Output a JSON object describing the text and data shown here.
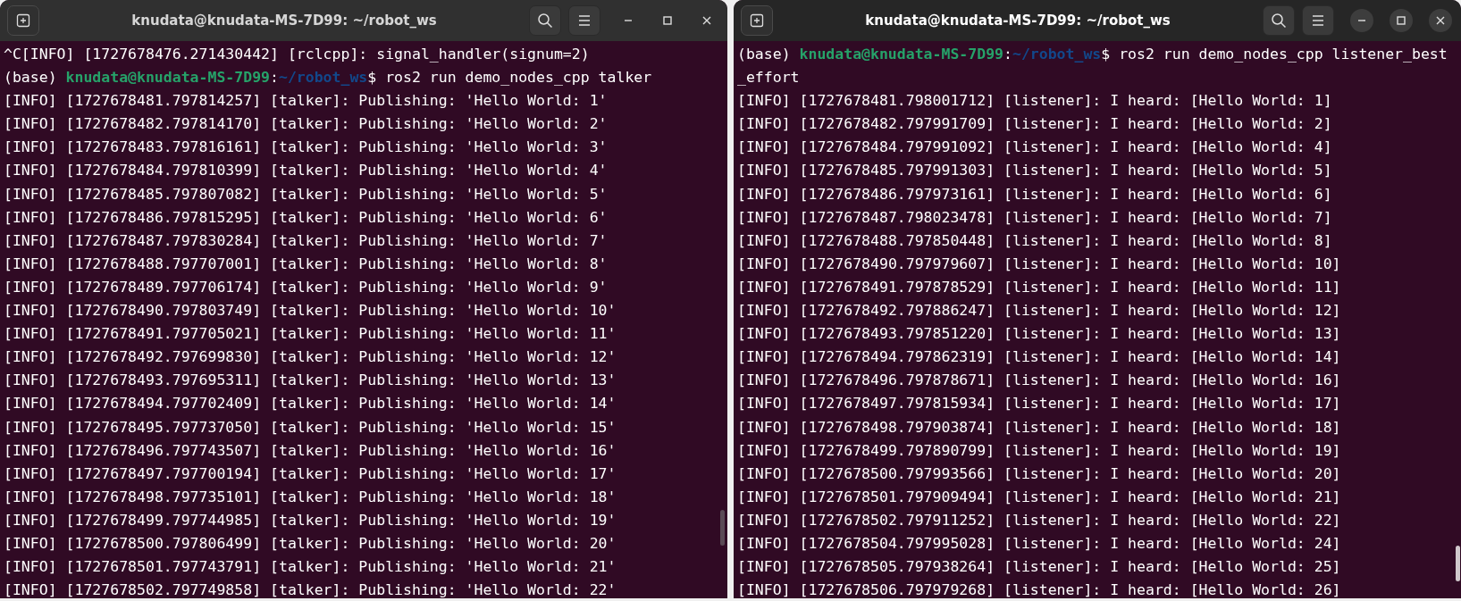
{
  "windows": [
    {
      "title": "knudata@knudata-MS-7D99: ~/robot_ws",
      "focused": false,
      "lines": [
        {
          "kind": "text",
          "text": "^C[INFO] [1727678476.271430442] [rclcpp]: signal_handler(signum=2)"
        },
        {
          "kind": "prompt",
          "env": "(base)",
          "user": "knudata@knudata-MS-7D99",
          "sep": ":",
          "path": "~/robot_ws",
          "command": "$ ros2 run demo_nodes_cpp talker"
        },
        {
          "kind": "text",
          "text": "[INFO] [1727678481.797814257] [talker]: Publishing: 'Hello World: 1'"
        },
        {
          "kind": "text",
          "text": "[INFO] [1727678482.797814170] [talker]: Publishing: 'Hello World: 2'"
        },
        {
          "kind": "text",
          "text": "[INFO] [1727678483.797816161] [talker]: Publishing: 'Hello World: 3'"
        },
        {
          "kind": "text",
          "text": "[INFO] [1727678484.797810399] [talker]: Publishing: 'Hello World: 4'"
        },
        {
          "kind": "text",
          "text": "[INFO] [1727678485.797807082] [talker]: Publishing: 'Hello World: 5'"
        },
        {
          "kind": "text",
          "text": "[INFO] [1727678486.797815295] [talker]: Publishing: 'Hello World: 6'"
        },
        {
          "kind": "text",
          "text": "[INFO] [1727678487.797830284] [talker]: Publishing: 'Hello World: 7'"
        },
        {
          "kind": "text",
          "text": "[INFO] [1727678488.797707001] [talker]: Publishing: 'Hello World: 8'"
        },
        {
          "kind": "text",
          "text": "[INFO] [1727678489.797706174] [talker]: Publishing: 'Hello World: 9'"
        },
        {
          "kind": "text",
          "text": "[INFO] [1727678490.797803749] [talker]: Publishing: 'Hello World: 10'"
        },
        {
          "kind": "text",
          "text": "[INFO] [1727678491.797705021] [talker]: Publishing: 'Hello World: 11'"
        },
        {
          "kind": "text",
          "text": "[INFO] [1727678492.797699830] [talker]: Publishing: 'Hello World: 12'"
        },
        {
          "kind": "text",
          "text": "[INFO] [1727678493.797695311] [talker]: Publishing: 'Hello World: 13'"
        },
        {
          "kind": "text",
          "text": "[INFO] [1727678494.797702409] [talker]: Publishing: 'Hello World: 14'"
        },
        {
          "kind": "text",
          "text": "[INFO] [1727678495.797737050] [talker]: Publishing: 'Hello World: 15'"
        },
        {
          "kind": "text",
          "text": "[INFO] [1727678496.797743507] [talker]: Publishing: 'Hello World: 16'"
        },
        {
          "kind": "text",
          "text": "[INFO] [1727678497.797700194] [talker]: Publishing: 'Hello World: 17'"
        },
        {
          "kind": "text",
          "text": "[INFO] [1727678498.797735101] [talker]: Publishing: 'Hello World: 18'"
        },
        {
          "kind": "text",
          "text": "[INFO] [1727678499.797744985] [talker]: Publishing: 'Hello World: 19'"
        },
        {
          "kind": "text",
          "text": "[INFO] [1727678500.797806499] [talker]: Publishing: 'Hello World: 20'"
        },
        {
          "kind": "text",
          "text": "[INFO] [1727678501.797743791] [talker]: Publishing: 'Hello World: 21'"
        },
        {
          "kind": "text",
          "text": "[INFO] [1727678502.797749858] [talker]: Publishing: 'Hello World: 22'"
        }
      ]
    },
    {
      "title": "knudata@knudata-MS-7D99: ~/robot_ws",
      "focused": true,
      "lines": [
        {
          "kind": "prompt",
          "env": "(base)",
          "user": "knudata@knudata-MS-7D99",
          "sep": ":",
          "path": "~/robot_ws",
          "command": "$ ros2 run demo_nodes_cpp listener_best"
        },
        {
          "kind": "text",
          "text": "_effort"
        },
        {
          "kind": "text",
          "text": "[INFO] [1727678481.798001712] [listener]: I heard: [Hello World: 1]"
        },
        {
          "kind": "text",
          "text": "[INFO] [1727678482.797991709] [listener]: I heard: [Hello World: 2]"
        },
        {
          "kind": "text",
          "text": "[INFO] [1727678484.797991092] [listener]: I heard: [Hello World: 4]"
        },
        {
          "kind": "text",
          "text": "[INFO] [1727678485.797991303] [listener]: I heard: [Hello World: 5]"
        },
        {
          "kind": "text",
          "text": "[INFO] [1727678486.797973161] [listener]: I heard: [Hello World: 6]"
        },
        {
          "kind": "text",
          "text": "[INFO] [1727678487.798023478] [listener]: I heard: [Hello World: 7]"
        },
        {
          "kind": "text",
          "text": "[INFO] [1727678488.797850448] [listener]: I heard: [Hello World: 8]"
        },
        {
          "kind": "text",
          "text": "[INFO] [1727678490.797979607] [listener]: I heard: [Hello World: 10]"
        },
        {
          "kind": "text",
          "text": "[INFO] [1727678491.797878529] [listener]: I heard: [Hello World: 11]"
        },
        {
          "kind": "text",
          "text": "[INFO] [1727678492.797886247] [listener]: I heard: [Hello World: 12]"
        },
        {
          "kind": "text",
          "text": "[INFO] [1727678493.797851220] [listener]: I heard: [Hello World: 13]"
        },
        {
          "kind": "text",
          "text": "[INFO] [1727678494.797862319] [listener]: I heard: [Hello World: 14]"
        },
        {
          "kind": "text",
          "text": "[INFO] [1727678496.797878671] [listener]: I heard: [Hello World: 16]"
        },
        {
          "kind": "text",
          "text": "[INFO] [1727678497.797815934] [listener]: I heard: [Hello World: 17]"
        },
        {
          "kind": "text",
          "text": "[INFO] [1727678498.797903874] [listener]: I heard: [Hello World: 18]"
        },
        {
          "kind": "text",
          "text": "[INFO] [1727678499.797890799] [listener]: I heard: [Hello World: 19]"
        },
        {
          "kind": "text",
          "text": "[INFO] [1727678500.797993566] [listener]: I heard: [Hello World: 20]"
        },
        {
          "kind": "text",
          "text": "[INFO] [1727678501.797909494] [listener]: I heard: [Hello World: 21]"
        },
        {
          "kind": "text",
          "text": "[INFO] [1727678502.797911252] [listener]: I heard: [Hello World: 22]"
        },
        {
          "kind": "text",
          "text": "[INFO] [1727678504.797995028] [listener]: I heard: [Hello World: 24]"
        },
        {
          "kind": "text",
          "text": "[INFO] [1727678505.797938264] [listener]: I heard: [Hello World: 25]"
        },
        {
          "kind": "text",
          "text": "[INFO] [1727678506.797979268] [listener]: I heard: [Hello World: 26]"
        }
      ]
    }
  ]
}
